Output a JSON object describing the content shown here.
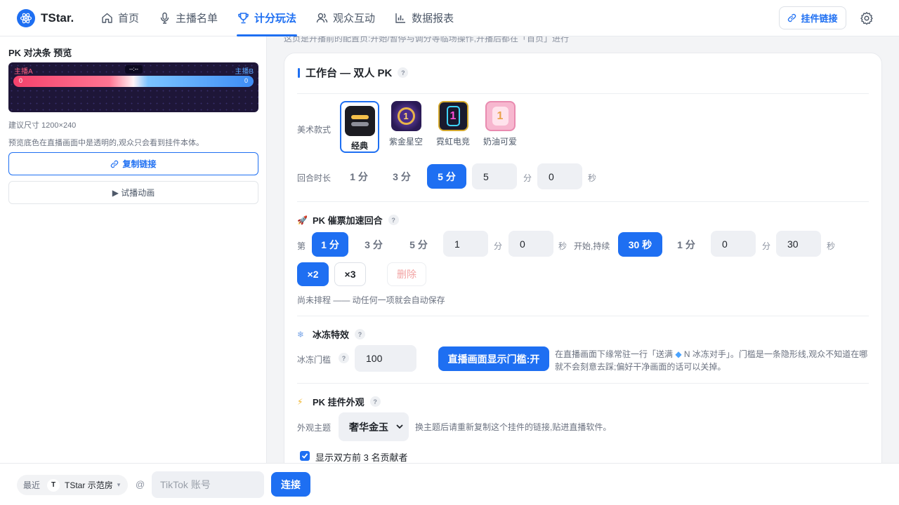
{
  "brand": {
    "name": "TStar.",
    "accent": "#1e6ff2"
  },
  "nav": {
    "items": [
      {
        "label": "首页",
        "icon": "home-icon"
      },
      {
        "label": "主播名单",
        "icon": "microphone-icon"
      },
      {
        "label": "计分玩法",
        "icon": "trophy-icon",
        "active": true
      },
      {
        "label": "观众互动",
        "icon": "users-icon"
      },
      {
        "label": "数据报表",
        "icon": "bar-chart-icon"
      }
    ]
  },
  "header": {
    "widget_link_label": "挂件链接"
  },
  "preview": {
    "title": "PK 对决条 预览",
    "host_a": "主播A",
    "host_b": "主播B",
    "timer": "--:--",
    "score_a": "0",
    "score_b": "0",
    "size_hint": "建议尺寸 1200×240",
    "transparent_hint": "预览底色在直播画面中是透明的,观众只会看到挂件本体。",
    "copy_label": "复制链接",
    "test_label": "▶ 试播动画"
  },
  "notice": "这页是开播前的配置页:开始/暂停与调分等临场操作,开播后都在「首页」进行",
  "workbench": {
    "title": "工作台 — 双人 PK",
    "style_label": "美术款式",
    "styles": [
      {
        "name": "经典",
        "selected": true
      },
      {
        "name": "紫金星空"
      },
      {
        "name": "霓虹电竞"
      },
      {
        "name": "奶油可爱"
      }
    ],
    "round_label": "回合时长",
    "round_options": [
      "1 分",
      "3 分",
      "5 分"
    ],
    "round_selected": "5 分",
    "round_min": "5",
    "round_min_unit": "分",
    "round_sec": "0",
    "round_sec_unit": "秒"
  },
  "boost": {
    "title": "PK 催票加速回合",
    "prefix": "第",
    "at_options": [
      "1 分",
      "3 分",
      "5 分"
    ],
    "at_selected": "1 分",
    "at_min": "1",
    "at_min_unit": "分",
    "at_sec": "0",
    "at_sec_unit": "秒",
    "start_text": "开始,持续",
    "dur_options": [
      "30 秒",
      "1 分"
    ],
    "dur_selected": "30 秒",
    "dur_min": "0",
    "dur_min_unit": "分",
    "dur_sec": "30",
    "dur_sec_unit": "秒",
    "mult_options": [
      "×2",
      "×3"
    ],
    "mult_selected": "×2",
    "delete_label": "删除",
    "status": "尚未排程 —— 动任何一项就会自动保存"
  },
  "freeze": {
    "title": "冰冻特效",
    "threshold_label": "冰冻门槛",
    "threshold_value": "100",
    "show_button": "直播画面显示门槛:开",
    "desc_prefix": "在直播画面下缘常驻一行「送满 ",
    "desc_suffix": " N 冰冻对手」。门槛是一条隐形线,观众不知道在哪就不会刻意去踩;偏好干净画面的话可以关掉。"
  },
  "appearance": {
    "title": "PK 挂件外观",
    "theme_label": "外观主题",
    "theme_value": "奢华金玉",
    "theme_hint": "换主题后请重新复制这个挂件的链接,贴进直播软件。",
    "show_top3_label": "显示双方前 3 名贡献者",
    "show_top3_checked": true
  },
  "footer": {
    "recent_label": "最近",
    "avatar_letter": "T",
    "room": "TStar 示范房",
    "at": "@",
    "tiktok_placeholder": "TikTok 账号",
    "connect_label": "连接"
  }
}
